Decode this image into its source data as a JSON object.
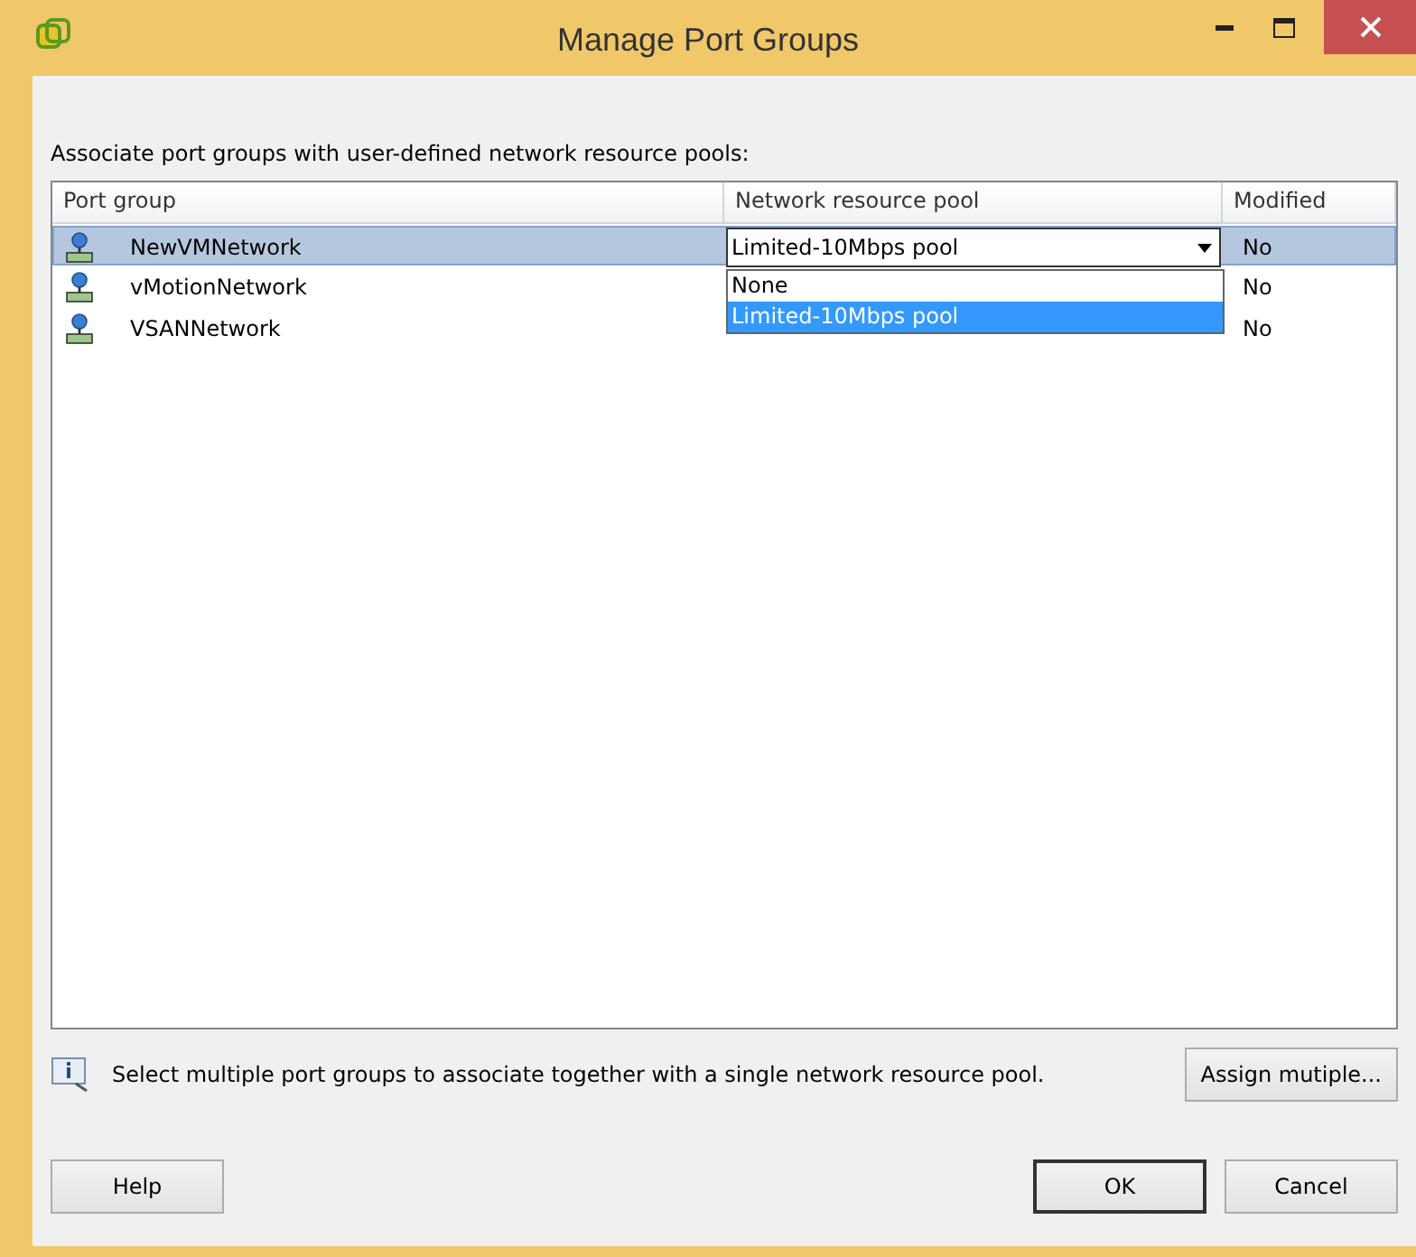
{
  "window": {
    "title": "Manage Port Groups"
  },
  "instruction": "Associate port groups with user-defined network resource pools:",
  "table": {
    "columns": [
      "Port group",
      "Network resource pool",
      "Modified"
    ],
    "rows": [
      {
        "name": "NewVMNetwork",
        "pool": "Limited-10Mbps pool",
        "modified": "No",
        "selected": true
      },
      {
        "name": "vMotionNetwork",
        "modified": "No",
        "selected": false
      },
      {
        "name": "VSANNetwork",
        "modified": "No",
        "selected": false
      }
    ]
  },
  "dropdown": {
    "options": [
      {
        "label": "None",
        "selected": false
      },
      {
        "label": "Limited-10Mbps pool",
        "selected": true
      }
    ]
  },
  "hint": "Select multiple port groups to associate together with a single network resource pool.",
  "buttons": {
    "assign": "Assign mutiple...",
    "help": "Help",
    "ok": "OK",
    "cancel": "Cancel"
  }
}
